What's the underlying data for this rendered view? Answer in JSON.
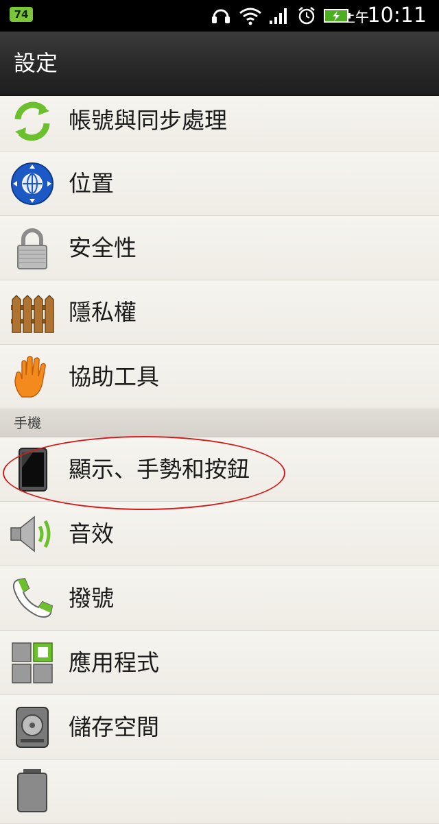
{
  "status_bar": {
    "battery_badge": "74",
    "ampm": "上午",
    "time": "10:11"
  },
  "header": {
    "title": "設定"
  },
  "settings": {
    "group1": [
      {
        "label": "帳號與同步處理",
        "icon": "sync-icon"
      },
      {
        "label": "位置",
        "icon": "location-globe-icon"
      },
      {
        "label": "安全性",
        "icon": "lock-icon"
      },
      {
        "label": "隱私權",
        "icon": "fence-icon"
      },
      {
        "label": "協助工具",
        "icon": "hand-icon"
      }
    ],
    "section_phone": "手機",
    "group2": [
      {
        "label": "顯示、手勢和按鈕",
        "icon": "phone-display-icon"
      },
      {
        "label": "音效",
        "icon": "speaker-icon"
      },
      {
        "label": "撥號",
        "icon": "phone-handset-icon"
      },
      {
        "label": "應用程式",
        "icon": "apps-grid-icon"
      },
      {
        "label": "儲存空間",
        "icon": "storage-icon"
      }
    ]
  },
  "colors": {
    "highlight": "#d41b1b",
    "status_badge": "#7cc43a"
  }
}
